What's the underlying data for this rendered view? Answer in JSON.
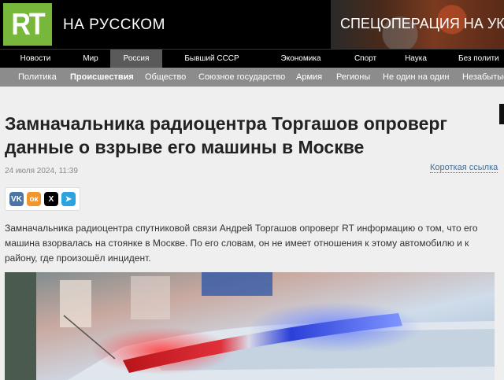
{
  "header": {
    "logo_text": "RT",
    "edition": "НА РУССКОМ",
    "promo_banner": "СПЕЦОПЕРАЦИЯ НА УК"
  },
  "main_nav": {
    "items": [
      "Новости",
      "Мир",
      "Россия",
      "Бывший СССР",
      "Экономика",
      "Спорт",
      "Наука",
      "Без полити"
    ],
    "active": "Россия"
  },
  "sub_nav": {
    "items": [
      "Политика",
      "Происшествия",
      "Общество",
      "Союзное государство",
      "Армия",
      "Регионы",
      "Не один на один",
      "Незабытые"
    ],
    "active": "Происшествия"
  },
  "article": {
    "title": "Замначальника радиоцентра Торгашов опроверг данные о взрыве его машины в Москве",
    "date": "24 июля 2024, 11:39",
    "short_link": "Короткая ссылка",
    "lead": "Замначальника радиоцентра спутниковой связи Андрей Торгашов опроверг RT информацию о том, что его машина взорвалась на стоянке в Москве. По его словам, он не имеет отношения к этому автомобилю и к району, где произошёл инцидент."
  },
  "share": {
    "buttons": [
      {
        "icon": "vk-icon",
        "glyph": "VK",
        "color": "#4c75a3"
      },
      {
        "icon": "odnoklassniki-icon",
        "glyph": "ок",
        "color": "#f2952a"
      },
      {
        "icon": "x-icon",
        "glyph": "X",
        "color": "#000000"
      },
      {
        "icon": "telegram-icon",
        "glyph": "➤",
        "color": "#2aa3df"
      }
    ]
  },
  "colors": {
    "brand_green": "#77b83c",
    "top_bar": "#000000",
    "subnav": "#8c8c8c",
    "link": "#3a6fa0"
  }
}
